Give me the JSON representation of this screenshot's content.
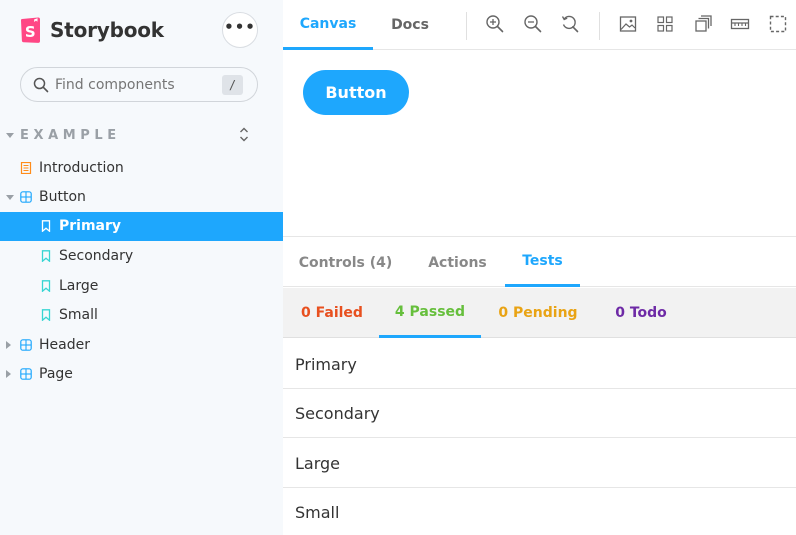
{
  "app": {
    "name": "Storybook",
    "menu_label": "•••"
  },
  "search": {
    "placeholder": "Find components",
    "shortcut": "/"
  },
  "sidebar": {
    "section_title": "EXAMPLE",
    "items": [
      {
        "label": "Introduction",
        "icon": "document-icon",
        "level": 0
      },
      {
        "label": "Button",
        "icon": "component-icon",
        "level": 0,
        "expanded": true
      },
      {
        "label": "Primary",
        "icon": "bookmark-icon",
        "level": 1,
        "selected": true
      },
      {
        "label": "Secondary",
        "icon": "bookmark-icon",
        "level": 1
      },
      {
        "label": "Large",
        "icon": "bookmark-icon",
        "level": 1
      },
      {
        "label": "Small",
        "icon": "bookmark-icon",
        "level": 1
      },
      {
        "label": "Header",
        "icon": "component-icon",
        "level": 0,
        "expanded": false
      },
      {
        "label": "Page",
        "icon": "component-icon",
        "level": 0,
        "expanded": false
      }
    ]
  },
  "toolbar": {
    "tabs": [
      {
        "label": "Canvas",
        "active": true
      },
      {
        "label": "Docs",
        "active": false
      }
    ],
    "tools": [
      "zoom-in-icon",
      "zoom-out-icon",
      "zoom-reset-icon",
      "background-icon",
      "grid-icon",
      "viewport-icon",
      "measure-icon",
      "outline-icon"
    ]
  },
  "canvas": {
    "button_label": "Button"
  },
  "panel": {
    "tabs": [
      {
        "label": "Controls (4)"
      },
      {
        "label": "Actions"
      },
      {
        "label": "Tests",
        "active": true
      }
    ],
    "filters": [
      {
        "label": "0 Failed",
        "color": "#e8501f"
      },
      {
        "label": "4 Passed",
        "color": "#66bf3c",
        "active": true
      },
      {
        "label": "0 Pending",
        "color": "#e9a314"
      },
      {
        "label": "0 Todo",
        "color": "#6e2aa6"
      }
    ],
    "results": [
      "Primary",
      "Secondary",
      "Large",
      "Small"
    ]
  },
  "colors": {
    "accent": "#1ea7fd",
    "brand": "#ff4785",
    "sidebar_bg": "#f6f9fc"
  }
}
